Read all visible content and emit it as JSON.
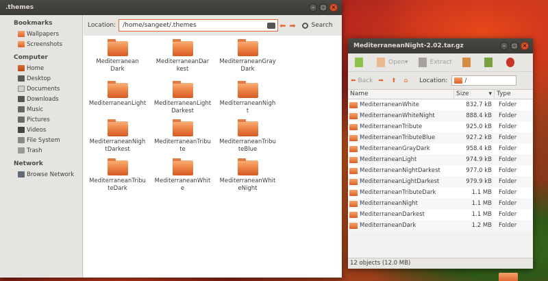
{
  "left_window": {
    "title": ".themes",
    "sidebar": [
      {
        "header": "Bookmarks",
        "items": [
          {
            "label": "Wallpapers",
            "icon": "folder-icon"
          },
          {
            "label": "Screenshots",
            "icon": "folder-icon"
          }
        ]
      },
      {
        "header": "Computer",
        "items": [
          {
            "label": "Home",
            "icon": "home-icon"
          },
          {
            "label": "Desktop",
            "icon": "desktop-icon"
          },
          {
            "label": "Documents",
            "icon": "documents-icon"
          },
          {
            "label": "Downloads",
            "icon": "downloads-icon"
          },
          {
            "label": "Music",
            "icon": "music-icon"
          },
          {
            "label": "Pictures",
            "icon": "pictures-icon"
          },
          {
            "label": "Videos",
            "icon": "videos-icon"
          },
          {
            "label": "File System",
            "icon": "drive-icon"
          },
          {
            "label": "Trash",
            "icon": "trash-icon"
          }
        ]
      },
      {
        "header": "Network",
        "items": [
          {
            "label": "Browse Network",
            "icon": "network-icon"
          }
        ]
      }
    ],
    "location_label": "Location:",
    "location_value": "/home/sangeet/.themes",
    "search_label": "Search",
    "folders": [
      [
        "Mediterranean",
        "Dark"
      ],
      [
        "MediterraneanDar",
        "kest"
      ],
      [
        "MediterraneanGray",
        "Dark"
      ],
      [
        "MediterraneanLight",
        ""
      ],
      [
        "MediterraneanLight",
        "Darkest"
      ],
      [
        "MediterraneanNigh",
        "t"
      ],
      [
        "MediterraneanNigh",
        "tDarkest"
      ],
      [
        "MediterraneanTribu",
        "te"
      ],
      [
        "MediterraneanTribu",
        "teBlue"
      ],
      [
        "MediterraneanTribu",
        "teDark"
      ],
      [
        "MediterraneanWhit",
        "e"
      ],
      [
        "MediterraneanWhit",
        "eNight"
      ]
    ]
  },
  "right_window": {
    "title": "MediterraneanNight-2.02.tar.gz",
    "toolbar": {
      "open_label": "Open",
      "extract_label": "Extract"
    },
    "nav": {
      "back_label": "Back",
      "location_label": "Location:",
      "location_value": "/"
    },
    "columns": [
      "Name",
      "Size",
      "Type"
    ],
    "rows": [
      {
        "name": "MediterraneanWhite",
        "size": "832.7 kB",
        "type": "Folder"
      },
      {
        "name": "MediterraneanWhiteNight",
        "size": "888.4 kB",
        "type": "Folder"
      },
      {
        "name": "MediterraneanTribute",
        "size": "925.0 kB",
        "type": "Folder"
      },
      {
        "name": "MediterraneanTributeBlue",
        "size": "927.2 kB",
        "type": "Folder"
      },
      {
        "name": "MediterraneanGrayDark",
        "size": "958.4 kB",
        "type": "Folder"
      },
      {
        "name": "MediterraneanLight",
        "size": "974.9 kB",
        "type": "Folder"
      },
      {
        "name": "MediterraneanNightDarkest",
        "size": "977.0 kB",
        "type": "Folder"
      },
      {
        "name": "MediterraneanLightDarkest",
        "size": "979.9 kB",
        "type": "Folder"
      },
      {
        "name": "MediterraneanTributeDark",
        "size": "1.1 MB",
        "type": "Folder"
      },
      {
        "name": "MediterraneanNight",
        "size": "1.1 MB",
        "type": "Folder"
      },
      {
        "name": "MediterraneanDarkest",
        "size": "1.1 MB",
        "type": "Folder"
      },
      {
        "name": "MediterraneanDark",
        "size": "1.2 MB",
        "type": "Folder"
      }
    ],
    "status": "12 objects (12.0 MB)"
  },
  "colors": {
    "accent": "#e06a36",
    "titlebar": "#3b3a36",
    "folder": "#df5e27"
  }
}
